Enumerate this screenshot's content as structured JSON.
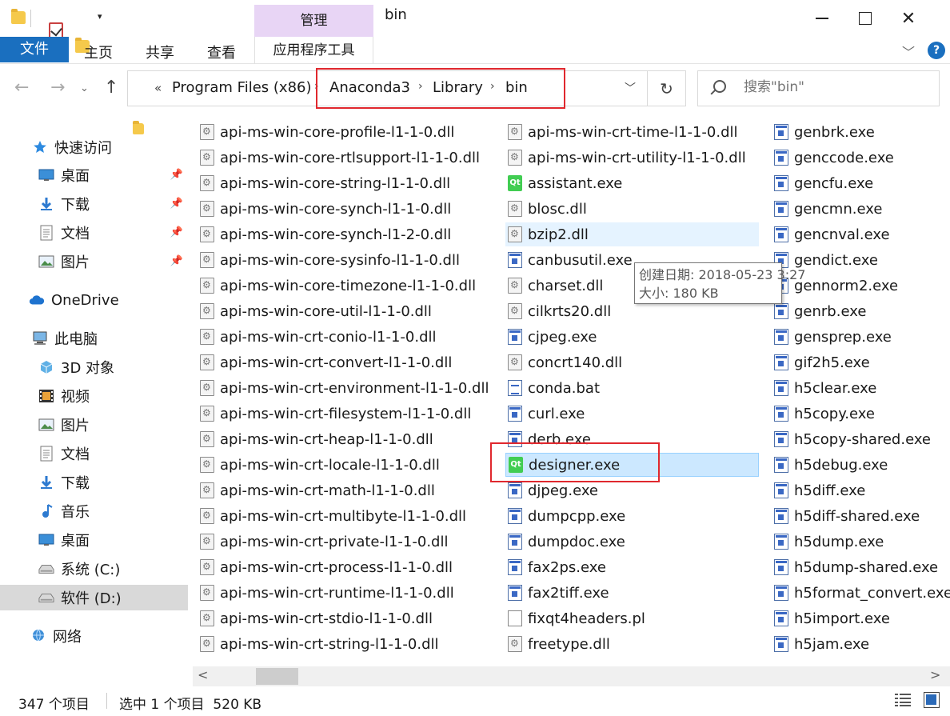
{
  "window": {
    "title": "bin",
    "context_tab_header": "管理",
    "context_tab_label": "应用程序工具"
  },
  "ribbon": {
    "tabs": [
      "文件",
      "主页",
      "共享",
      "查看"
    ]
  },
  "address": {
    "overflow": "«",
    "crumbs": [
      "Program Files (x86)",
      "Anaconda3",
      "Library",
      "bin"
    ],
    "search_placeholder": "搜索\"bin\""
  },
  "sidebar": {
    "items": [
      {
        "label": "快速访问",
        "icon": "star-icon",
        "pinned": false
      },
      {
        "label": "桌面",
        "icon": "desktop-icon",
        "pinned": true
      },
      {
        "label": "下载",
        "icon": "download-icon",
        "pinned": true
      },
      {
        "label": "文档",
        "icon": "documents-icon",
        "pinned": true
      },
      {
        "label": "图片",
        "icon": "pictures-icon",
        "pinned": true
      },
      {
        "label": "OneDrive",
        "icon": "cloud-icon",
        "pinned": false
      },
      {
        "label": "此电脑",
        "icon": "computer-icon",
        "pinned": false
      },
      {
        "label": "3D 对象",
        "icon": "3d-objects-icon",
        "pinned": false
      },
      {
        "label": "视频",
        "icon": "video-icon",
        "pinned": false
      },
      {
        "label": "图片",
        "icon": "pictures-icon",
        "pinned": false
      },
      {
        "label": "文档",
        "icon": "documents-icon",
        "pinned": false
      },
      {
        "label": "下载",
        "icon": "download-icon",
        "pinned": false
      },
      {
        "label": "音乐",
        "icon": "music-icon",
        "pinned": false
      },
      {
        "label": "桌面",
        "icon": "desktop-icon",
        "pinned": false
      },
      {
        "label": "系统 (C:)",
        "icon": "drive-icon",
        "pinned": false
      },
      {
        "label": "软件 (D:)",
        "icon": "drive-icon",
        "pinned": false
      },
      {
        "label": "网络",
        "icon": "network-icon",
        "pinned": false
      }
    ]
  },
  "files": {
    "col1": [
      {
        "name": "api-ms-win-core-profile-l1-1-0.dll",
        "type": "dll"
      },
      {
        "name": "api-ms-win-core-rtlsupport-l1-1-0.dll",
        "type": "dll"
      },
      {
        "name": "api-ms-win-core-string-l1-1-0.dll",
        "type": "dll"
      },
      {
        "name": "api-ms-win-core-synch-l1-1-0.dll",
        "type": "dll"
      },
      {
        "name": "api-ms-win-core-synch-l1-2-0.dll",
        "type": "dll"
      },
      {
        "name": "api-ms-win-core-sysinfo-l1-1-0.dll",
        "type": "dll"
      },
      {
        "name": "api-ms-win-core-timezone-l1-1-0.dll",
        "type": "dll"
      },
      {
        "name": "api-ms-win-core-util-l1-1-0.dll",
        "type": "dll"
      },
      {
        "name": "api-ms-win-crt-conio-l1-1-0.dll",
        "type": "dll"
      },
      {
        "name": "api-ms-win-crt-convert-l1-1-0.dll",
        "type": "dll"
      },
      {
        "name": "api-ms-win-crt-environment-l1-1-0.dll",
        "type": "dll"
      },
      {
        "name": "api-ms-win-crt-filesystem-l1-1-0.dll",
        "type": "dll"
      },
      {
        "name": "api-ms-win-crt-heap-l1-1-0.dll",
        "type": "dll"
      },
      {
        "name": "api-ms-win-crt-locale-l1-1-0.dll",
        "type": "dll"
      },
      {
        "name": "api-ms-win-crt-math-l1-1-0.dll",
        "type": "dll"
      },
      {
        "name": "api-ms-win-crt-multibyte-l1-1-0.dll",
        "type": "dll"
      },
      {
        "name": "api-ms-win-crt-private-l1-1-0.dll",
        "type": "dll"
      },
      {
        "name": "api-ms-win-crt-process-l1-1-0.dll",
        "type": "dll"
      },
      {
        "name": "api-ms-win-crt-runtime-l1-1-0.dll",
        "type": "dll"
      },
      {
        "name": "api-ms-win-crt-stdio-l1-1-0.dll",
        "type": "dll"
      },
      {
        "name": "api-ms-win-crt-string-l1-1-0.dll",
        "type": "dll"
      }
    ],
    "col2": [
      {
        "name": "api-ms-win-crt-time-l1-1-0.dll",
        "type": "dll"
      },
      {
        "name": "api-ms-win-crt-utility-l1-1-0.dll",
        "type": "dll"
      },
      {
        "name": "assistant.exe",
        "type": "qt"
      },
      {
        "name": "blosc.dll",
        "type": "dll"
      },
      {
        "name": "bzip2.dll",
        "type": "dll",
        "state": "hover"
      },
      {
        "name": "canbusutil.exe",
        "type": "exe"
      },
      {
        "name": "charset.dll",
        "type": "dll"
      },
      {
        "name": "cilkrts20.dll",
        "type": "dll"
      },
      {
        "name": "cjpeg.exe",
        "type": "exe"
      },
      {
        "name": "concrt140.dll",
        "type": "dll"
      },
      {
        "name": "conda.bat",
        "type": "bat"
      },
      {
        "name": "curl.exe",
        "type": "exe"
      },
      {
        "name": "derb.exe",
        "type": "exe"
      },
      {
        "name": "designer.exe",
        "type": "qt",
        "state": "selected"
      },
      {
        "name": "djpeg.exe",
        "type": "exe"
      },
      {
        "name": "dumpcpp.exe",
        "type": "exe"
      },
      {
        "name": "dumpdoc.exe",
        "type": "exe"
      },
      {
        "name": "fax2ps.exe",
        "type": "exe"
      },
      {
        "name": "fax2tiff.exe",
        "type": "exe"
      },
      {
        "name": "fixqt4headers.pl",
        "type": "pl"
      },
      {
        "name": "freetype.dll",
        "type": "dll"
      }
    ],
    "col3": [
      {
        "name": "genbrk.exe",
        "type": "exe"
      },
      {
        "name": "genccode.exe",
        "type": "exe"
      },
      {
        "name": "gencfu.exe",
        "type": "exe"
      },
      {
        "name": "gencmn.exe",
        "type": "exe"
      },
      {
        "name": "gencnval.exe",
        "type": "exe"
      },
      {
        "name": "gendict.exe",
        "type": "exe"
      },
      {
        "name": "gennorm2.exe",
        "type": "exe"
      },
      {
        "name": "genrb.exe",
        "type": "exe"
      },
      {
        "name": "gensprep.exe",
        "type": "exe"
      },
      {
        "name": "gif2h5.exe",
        "type": "exe"
      },
      {
        "name": "h5clear.exe",
        "type": "exe"
      },
      {
        "name": "h5copy.exe",
        "type": "exe"
      },
      {
        "name": "h5copy-shared.exe",
        "type": "exe"
      },
      {
        "name": "h5debug.exe",
        "type": "exe"
      },
      {
        "name": "h5diff.exe",
        "type": "exe"
      },
      {
        "name": "h5diff-shared.exe",
        "type": "exe"
      },
      {
        "name": "h5dump.exe",
        "type": "exe"
      },
      {
        "name": "h5dump-shared.exe",
        "type": "exe"
      },
      {
        "name": "h5format_convert.exe",
        "type": "exe"
      },
      {
        "name": "h5import.exe",
        "type": "exe"
      },
      {
        "name": "h5jam.exe",
        "type": "exe"
      }
    ]
  },
  "tooltip": {
    "created": "创建日期: 2018-05-23 3:27",
    "size": "大小: 180 KB"
  },
  "status": {
    "count": "347 个项目",
    "selected": "选中 1 个项目  520 KB"
  },
  "colors": {
    "accent": "#1a6fbf",
    "context_tab": "#e8d5f5",
    "annotation": "#e0282e",
    "selection": "#cce8ff"
  }
}
